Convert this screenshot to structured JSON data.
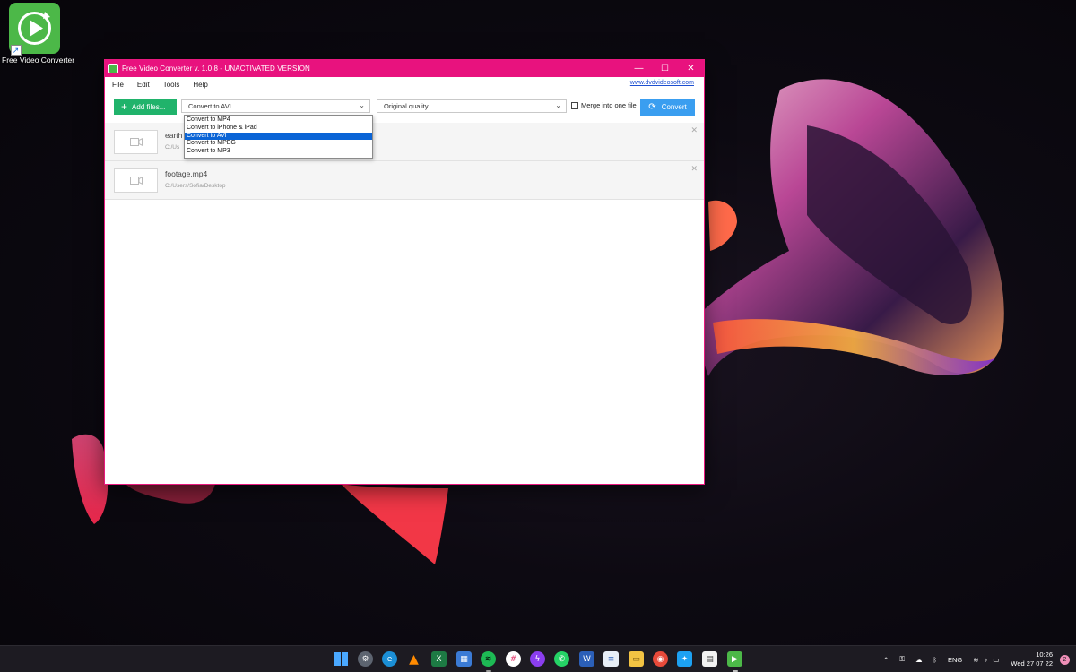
{
  "desktop": {
    "icon_label": "Free Video Converter"
  },
  "window": {
    "title": "Free Video Converter v. 1.0.8 - UNACTIVATED VERSION",
    "controls": {
      "minimize": "—",
      "maximize": "☐",
      "close": "✕"
    }
  },
  "menu": {
    "items": [
      "File",
      "Edit",
      "Tools",
      "Help"
    ],
    "website": "www.dvdvideosoft.com"
  },
  "toolbar": {
    "add_files_label": "Add files...",
    "format_selected": "Convert to AVI",
    "quality_selected": "Original quality",
    "merge_label": "Merge into one file",
    "merge_checked": false,
    "convert_label": "Convert"
  },
  "format_dropdown": {
    "options": [
      "Convert to MP4",
      "Convert to iPhone & iPad",
      "Convert to AVI",
      "Convert to MPEG",
      "Convert to MP3"
    ],
    "selected": "Convert to AVI"
  },
  "files": [
    {
      "name": "earth",
      "path": "C:/Us"
    },
    {
      "name": "footage.mp4",
      "path": "C:/Users/Sofia/Desktop"
    }
  ],
  "taskbar": {
    "icons": [
      "windows-start-icon",
      "settings-icon",
      "edge-icon",
      "vlc-icon",
      "excel-icon",
      "store-app-icon",
      "spotify-icon",
      "slack-icon",
      "messenger-icon",
      "whatsapp-icon",
      "word-icon",
      "notepad-icon",
      "file-explorer-icon",
      "chrome-icon",
      "twitter-icon",
      "calendar-icon",
      "free-video-converter-icon"
    ],
    "tray_lang": "ENG",
    "time": "10:26",
    "date": "Wed 27 07 22",
    "notification_count": "2"
  },
  "colors": {
    "titlebar": "#e8127e",
    "add_button": "#20b36b",
    "convert_button": "#3a9ef0",
    "dropdown_highlight": "#0a64d6",
    "app_icon": "#4cb848"
  }
}
